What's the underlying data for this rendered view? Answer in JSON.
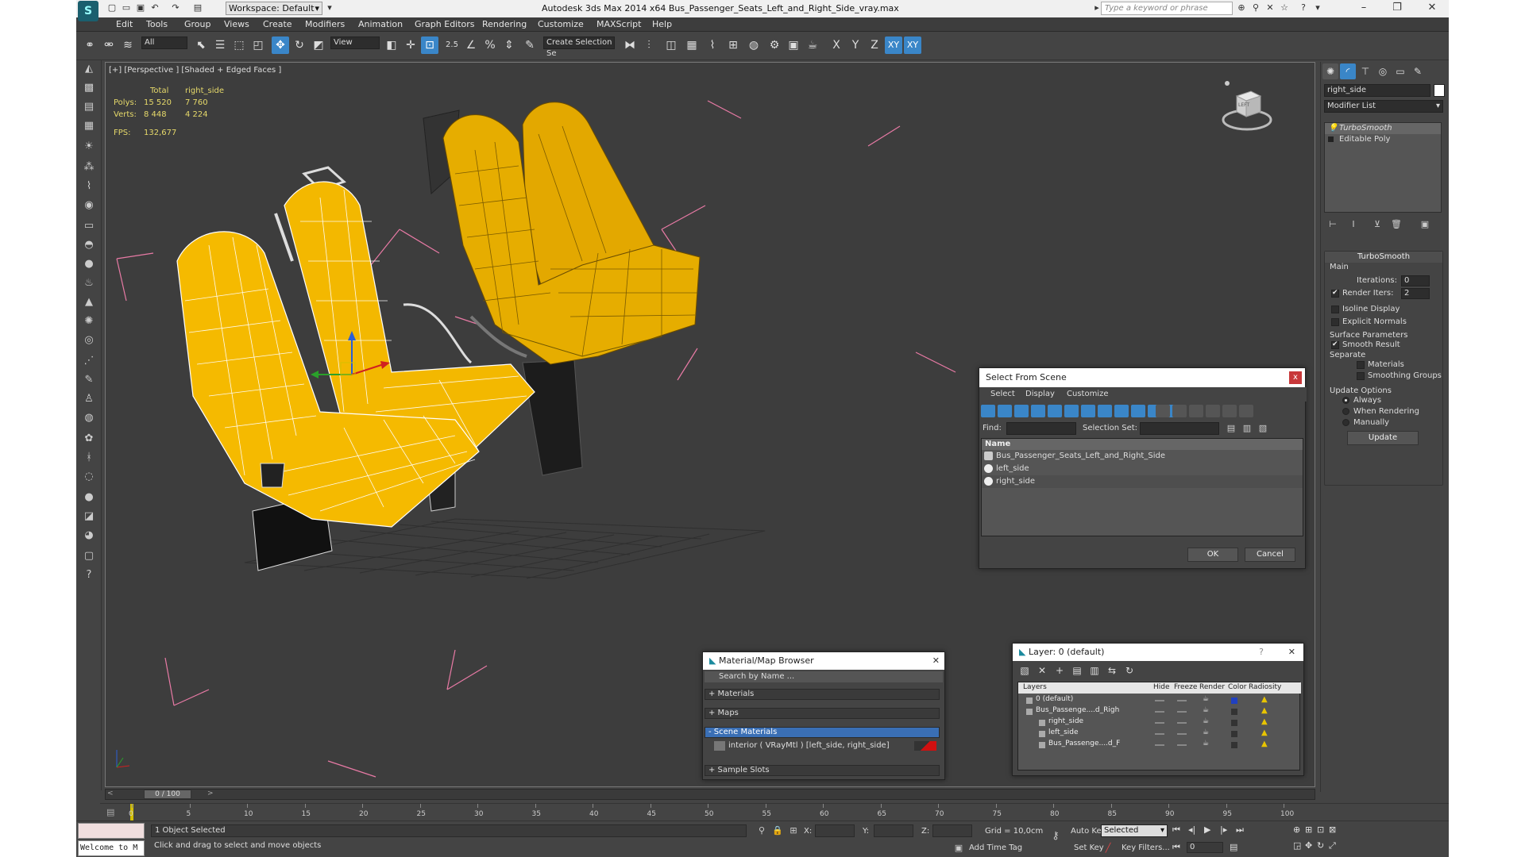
{
  "app": {
    "title": "Autodesk 3ds Max  2014 x64      Bus_Passenger_Seats_Left_and_Right_Side_vray.max",
    "workspace": "Workspace: Default",
    "search_placeholder": "Type a keyword or phrase"
  },
  "menu": [
    "Edit",
    "Tools",
    "Group",
    "Views",
    "Create",
    "Modifiers",
    "Animation",
    "Graph Editors",
    "Rendering",
    "Customize",
    "MAXScript",
    "Help"
  ],
  "toolbar": {
    "filter": "All",
    "ref_coord": "View",
    "snap_value": "2.5",
    "named_selection": "Create Selection Se",
    "axes": [
      "X",
      "Y",
      "Z",
      "XY",
      "XY"
    ]
  },
  "viewport": {
    "label": "[+] [Perspective ] [Shaded + Edged Faces ]",
    "stats": {
      "header_total": "Total",
      "header_object": "right_side",
      "polys_label": "Polys:",
      "polys_total": "15 520",
      "polys_object": "7 760",
      "verts_label": "Verts:",
      "verts_total": "8 448",
      "verts_object": "4 224",
      "fps_label": "FPS:",
      "fps_value": "132,677"
    },
    "viewcube_label": "LEFT",
    "gizmo_z": "z"
  },
  "command_panel": {
    "object_name": "right_side",
    "modifier_list": "Modifier List",
    "stack": [
      "TurboSmooth",
      "Editable Poly"
    ],
    "turbosmooth": {
      "title": "TurboSmooth",
      "main": "Main",
      "iterations_label": "Iterations:",
      "iterations": "0",
      "render_iters_label": "Render Iters:",
      "render_iters": "2",
      "isoline": "Isoline Display",
      "explicit": "Explicit Normals",
      "surface_params": "Surface Parameters",
      "smooth_result": "Smooth Result",
      "separate": "Separate",
      "materials": "Materials",
      "smoothing_groups": "Smoothing Groups",
      "update_options": "Update Options",
      "always": "Always",
      "when_rendering": "When Rendering",
      "manually": "Manually",
      "update": "Update"
    }
  },
  "select_from_scene": {
    "title": "Select From Scene",
    "menu": [
      "Select",
      "Display",
      "Customize"
    ],
    "find_label": "Find:",
    "selset_label": "Selection Set:",
    "column": "Name",
    "items": [
      "Bus_Passenger_Seats_Left_and_Right_Side",
      "left_side",
      "right_side"
    ],
    "ok": "OK",
    "cancel": "Cancel"
  },
  "material_browser": {
    "title": "Material/Map Browser",
    "search": "Search by Name ...",
    "sections": [
      "+ Materials",
      "+ Maps",
      "- Scene Materials",
      "+ Sample Slots"
    ],
    "scene_material": "interior  ( VRayMtl )  [left_side, right_side]"
  },
  "layer_dialog": {
    "title": "Layer: 0 (default)",
    "columns": [
      "Layers",
      "Hide",
      "Freeze",
      "Render",
      "Color",
      "Radiosity"
    ],
    "rows": [
      "0 (default)",
      "Bus_Passenge....d_Righ",
      "right_side",
      "left_side",
      "Bus_Passenge....d_F"
    ]
  },
  "timeline": {
    "frame": "0 / 100",
    "ticks": [
      "0",
      "5",
      "10",
      "15",
      "20",
      "25",
      "30",
      "35",
      "40",
      "45",
      "50",
      "55",
      "60",
      "65",
      "70",
      "75",
      "80",
      "85",
      "90",
      "95",
      "100"
    ]
  },
  "status": {
    "selected": "1 Object Selected",
    "prompt": "Click and drag to select and move objects",
    "welcome": "Welcome to M",
    "x_label": "X:",
    "y_label": "Y:",
    "z_label": "Z:",
    "grid": "Grid = 10,0cm",
    "autokey": "Auto Key",
    "selected_dd": "Selected",
    "setkey": "Set Key",
    "keyfilters": "Key Filters...",
    "add_time_tag": "Add Time Tag",
    "frame_field": "0"
  }
}
